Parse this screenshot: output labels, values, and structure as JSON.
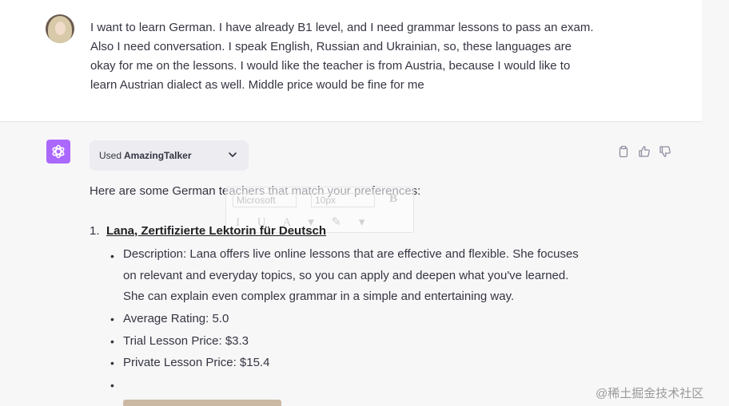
{
  "user_message": {
    "lines": [
      "I want to learn German. I have already B1 level, and I need grammar lessons to pass an exam.",
      "Also I need conversation. I speak English, Russian and Ukrainian, so, these languages are",
      "okay for me on the lessons. I would like the teacher is from Austria, because I would like to",
      "learn Austrian dialect as well. Middle price would be fine for me"
    ]
  },
  "plugin": {
    "prefix": "Used",
    "name": "AmazingTalker"
  },
  "response": {
    "intro": "Here are some German teachers that match your preferences:",
    "teachers": [
      {
        "number": "1.",
        "name": "Lana, Zertifizierte Lektorin für Deutsch",
        "description_lines": [
          "Description: Lana offers live online lessons that are effective and flexible. She focuses",
          "on relevant and everyday topics, so you can apply and deepen what you've learned.",
          "She can explain even complex grammar in a simple and entertaining way."
        ],
        "average_rating": "Average Rating: 5.0",
        "trial_price": "Trial Lesson Price: $3.3",
        "private_price": "Private Lesson Price: $15.4"
      }
    ]
  },
  "ghost_toolbar": {
    "font": "Microsoft",
    "size": "10px",
    "bold": "B",
    "row2": "I U A ▾ ✎ ▾"
  },
  "watermark": "@稀土掘金技术社区",
  "colors": {
    "assistant_avatar": "#ab68ff",
    "assistant_bg": "#f7f7f8",
    "text": "#343541"
  },
  "icons": [
    "user-avatar",
    "openai-logo-icon",
    "chevron-down-icon",
    "copy-icon",
    "thumbs-up-icon",
    "thumbs-down-icon"
  ]
}
